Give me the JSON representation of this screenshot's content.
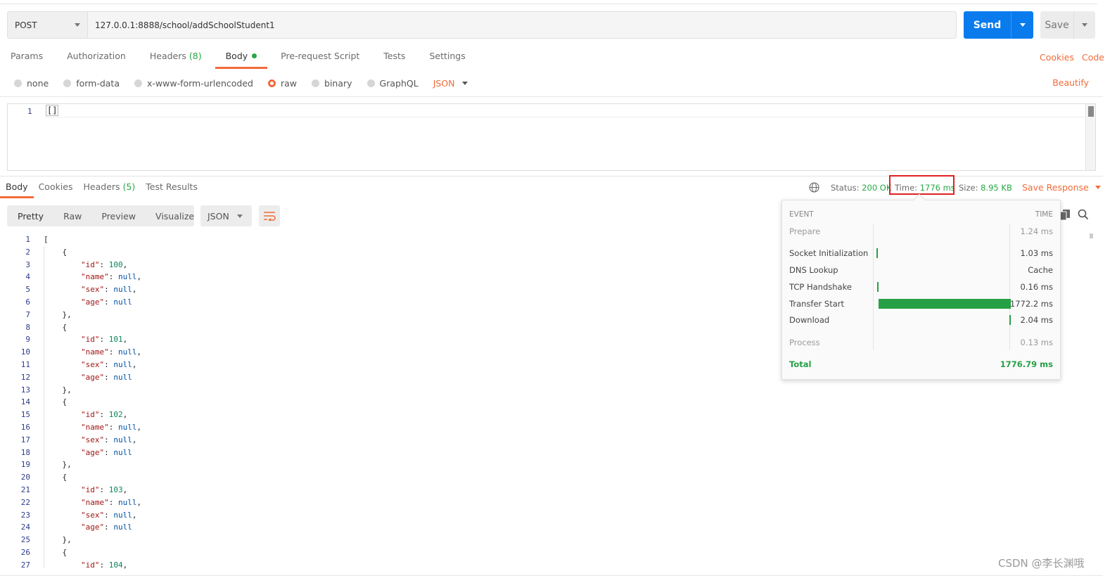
{
  "request": {
    "method": "POST",
    "url": "127.0.0.1:8888/school/addSchoolStudent1",
    "send_label": "Send",
    "save_label": "Save",
    "tabs": [
      {
        "label": "Params"
      },
      {
        "label": "Authorization"
      },
      {
        "label": "Headers",
        "count": "(8)"
      },
      {
        "label": "Body"
      },
      {
        "label": "Pre-request Script"
      },
      {
        "label": "Tests"
      },
      {
        "label": "Settings"
      }
    ],
    "links": {
      "cookies": "Cookies",
      "code": "Code"
    },
    "body_types": [
      "none",
      "form-data",
      "x-www-form-urlencoded",
      "raw",
      "binary",
      "GraphQL"
    ],
    "language": "JSON",
    "beautify": "Beautify",
    "editor": {
      "line": "1",
      "text": "[]"
    }
  },
  "response": {
    "tabs": [
      {
        "label": "Body"
      },
      {
        "label": "Cookies"
      },
      {
        "label": "Headers",
        "count": "(5)"
      },
      {
        "label": "Test Results"
      }
    ],
    "status_label": "Status:",
    "status_value": "200 OK",
    "time_label": "Time:",
    "time_value": "1776 ms",
    "size_label": "Size:",
    "size_value": "8.95 KB",
    "save_response": "Save Response",
    "view_modes": [
      "Pretty",
      "Raw",
      "Preview",
      "Visualize"
    ],
    "format": "JSON",
    "records": [
      {
        "id": "100"
      },
      {
        "id": "101"
      },
      {
        "id": "102"
      },
      {
        "id": "103"
      },
      {
        "id": "104"
      }
    ]
  },
  "timing": {
    "header_event": "EVENT",
    "header_time": "TIME",
    "rows": [
      {
        "event": "Prepare",
        "time": "1.24 ms",
        "bar_fraction": 0
      },
      {
        "event": "Socket Initialization",
        "time": "1.03 ms",
        "bar_fraction": 0.001
      },
      {
        "event": "DNS Lookup",
        "time": "Cache",
        "bar_fraction": 0
      },
      {
        "event": "TCP Handshake",
        "time": "0.16 ms",
        "bar_fraction": 0.0001
      },
      {
        "event": "Transfer Start",
        "time": "1772.2 ms",
        "bar_fraction": 0.998
      },
      {
        "event": "Download",
        "time": "2.04 ms",
        "bar_fraction": 0.001
      },
      {
        "event": "Process",
        "time": "0.13 ms",
        "bar_fraction": 0
      }
    ],
    "total_label": "Total",
    "total_time": "1776.79 ms"
  },
  "watermark": "CSDN @李长渊哦",
  "colors": {
    "accent": "#f26b3a",
    "send": "#097bed",
    "success": "#26a844",
    "highlight_box": "#e02020"
  }
}
